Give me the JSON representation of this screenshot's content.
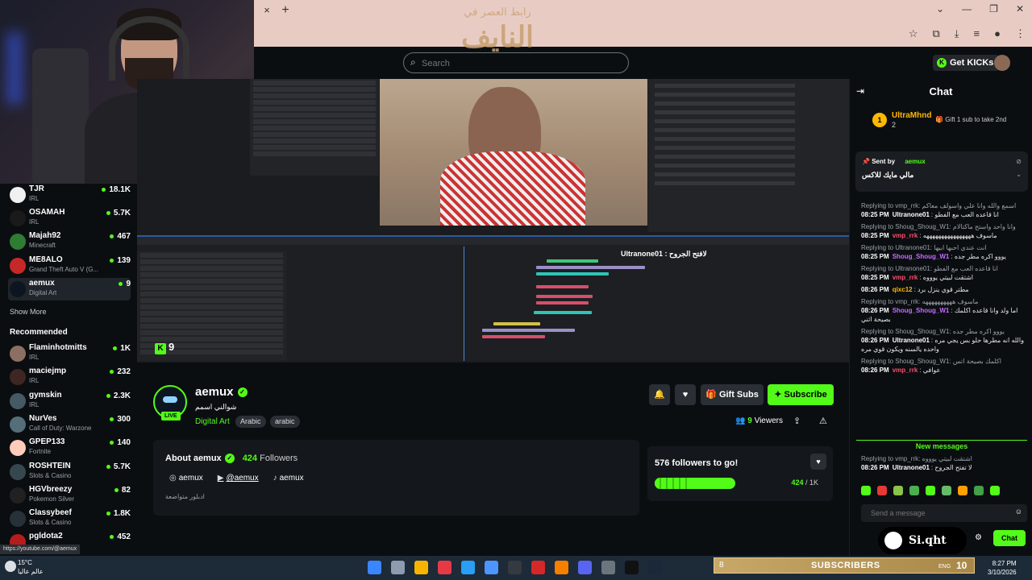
{
  "browser": {
    "close_tab": "×",
    "new_tab": "+",
    "window_buttons": [
      "⌄",
      "—",
      "❐",
      "✕"
    ],
    "toolbar_icons": [
      "☆",
      "⧉",
      "⤓",
      "≡",
      "●",
      "⋮"
    ]
  },
  "watermark": {
    "top": "رابط العصر في",
    "big": "النايف"
  },
  "header": {
    "search_placeholder": "Search",
    "get_kicks": "Get KICKs"
  },
  "sidebar": {
    "following": [
      {
        "name": "TJR",
        "category": "IRL",
        "viewers": "18.1K",
        "color": "#f0f0f0"
      },
      {
        "name": "OSAMAH",
        "category": "IRL",
        "viewers": "5.7K",
        "color": "#1a1a1a"
      },
      {
        "name": "Majah92",
        "category": "Minecraft",
        "viewers": "467",
        "color": "#2e7d32"
      },
      {
        "name": "ME8ALO",
        "category": "Grand Theft Auto V (G...",
        "viewers": "139",
        "color": "#c62828"
      },
      {
        "name": "aemux",
        "category": "Digital Art",
        "viewers": "9",
        "color": "#0d1620"
      }
    ],
    "show_more": "Show More",
    "recommended_title": "Recommended",
    "recommended": [
      {
        "name": "Flaminhotmitts",
        "category": "IRL",
        "viewers": "1K",
        "color": "#8d6e63"
      },
      {
        "name": "maciejmp",
        "category": "IRL",
        "viewers": "232",
        "color": "#3e2723"
      },
      {
        "name": "gymskin",
        "category": "IRL",
        "viewers": "2.3K",
        "color": "#455a64"
      },
      {
        "name": "NurVes",
        "category": "Call of Duty: Warzone",
        "viewers": "300",
        "color": "#546e7a"
      },
      {
        "name": "GPEP133",
        "category": "Fortnite",
        "viewers": "140",
        "color": "#ffccbc"
      },
      {
        "name": "ROSHTEIN",
        "category": "Slots & Casino",
        "viewers": "5.7K",
        "color": "#37474f"
      },
      {
        "name": "HGVbreezy",
        "category": "Pokemon Silver",
        "viewers": "82",
        "color": "#212121"
      },
      {
        "name": "Classybeef",
        "category": "Slots & Casino",
        "viewers": "1.8K",
        "color": "#263238"
      },
      {
        "name": "pgldota2",
        "category": "",
        "viewers": "452",
        "color": "#b71c1c"
      }
    ]
  },
  "video": {
    "overlay_text": "Ultranone01 : لافتح الجروح",
    "kick_count": "9"
  },
  "channel": {
    "name": "aemux",
    "live": "LIVE",
    "title": "شوالني اسمم",
    "category": "Digital Art",
    "tags": [
      "Arabic",
      "arabic"
    ],
    "gift_subs": "Gift Subs",
    "subscribe": "Subscribe",
    "viewers_count": "9",
    "viewers_label": "Viewers"
  },
  "about": {
    "title": "About aemux",
    "followers_count": "424",
    "followers_label": "Followers",
    "socials": [
      {
        "icon": "instagram-icon",
        "label": "aemux"
      },
      {
        "icon": "youtube-icon",
        "label": "@aemux"
      },
      {
        "icon": "tiktok-icon",
        "label": "aemux"
      }
    ],
    "description": "ادبلور متواضعة"
  },
  "goal": {
    "title": "576 followers to go!",
    "current": "424",
    "target": "/ 1K",
    "progress": 0.424
  },
  "chat": {
    "title": "Chat",
    "top_gifter": {
      "rank": "1",
      "name": "UltraMhnd",
      "count": "2",
      "gift_text": "Gift 1 sub to take 2nd"
    },
    "pinned": {
      "sent_by": "Sent by",
      "user": "aemux",
      "message": "مالي مايك للاكس"
    },
    "messages": [
      {
        "reply": "Replying to vmp_rrk: اسمع والله وانا علي واسولف معاكم",
        "time": "08:25 PM",
        "user": "Ultranone01",
        "color": "#ffffff",
        "text": "انا قاعده العب مع الفطو"
      },
      {
        "reply": "Replying to Shoug_Shoug_W1: وانا واحد واستح ماكتالام",
        "time": "08:25 PM",
        "user": "vmp_rrk",
        "color": "#ff4d6d",
        "text": "ماسوف ههههههههههههههههه"
      },
      {
        "reply": "Replying to Ultranone01: انت عندي احبها ابيها",
        "time": "08:25 PM",
        "user": "Shoug_Shoug_W1",
        "color": "#c56bff",
        "text": "يووو اكره مطر جده"
      },
      {
        "reply": "Replying to Ultranone01: انا قاعده العب مع الفطو",
        "time": "08:25 PM",
        "user": "vmp_rrk",
        "color": "#ff4d6d",
        "text": "اشتقت لبيتي يوووه"
      },
      {
        "reply": "",
        "time": "08:26 PM",
        "user": "qixc12",
        "color": "#ffb800",
        "text": "مطتر قوي ينزل برد"
      },
      {
        "reply": "Replying to vmp_rrk: ماسوف ههههههههههه",
        "time": "08:26 PM",
        "user": "Shoug_Shoug_W1",
        "color": "#c56bff",
        "text": "اما ولد وانا قاعده اكلمك بصيحة اثني"
      },
      {
        "reply": "Replying to Shoug_Shoug_W1: يووو اكره مطر جده",
        "time": "08:26 PM",
        "user": "Ultranone01",
        "color": "#ffffff",
        "text": "والله انه مطرها حلو بس يجي مره واحده يالسنه ويكون قوي مره"
      },
      {
        "reply": "Replying to Shoug_Shoug_W1: اكلمك بصيحة اتس",
        "time": "08:26 PM",
        "user": "vmp_rrk",
        "color": "#ff4d6d",
        "text": "عوافي"
      }
    ],
    "new_messages": "New messages",
    "last_message": {
      "reply": "Replying to vmp_rrk: اشتقت لبيتي يوووه",
      "time": "08:26 PM",
      "user": "Ultranone01",
      "color": "#ffffff",
      "text": "لا تفتح الجروح"
    },
    "input_placeholder": "Send a message",
    "send": "Chat",
    "siqht": "Si.qht"
  },
  "status_url": "https://youtube.com/@aemux",
  "taskbar": {
    "temp": "15°C",
    "weather_text": "عالم عاليا",
    "subs_count": "8",
    "subs_label": "SUBSCRIBERS",
    "subs_goal": "10",
    "lang": "ENG",
    "time": "8:27 PM",
    "date": "3/10/2026"
  }
}
